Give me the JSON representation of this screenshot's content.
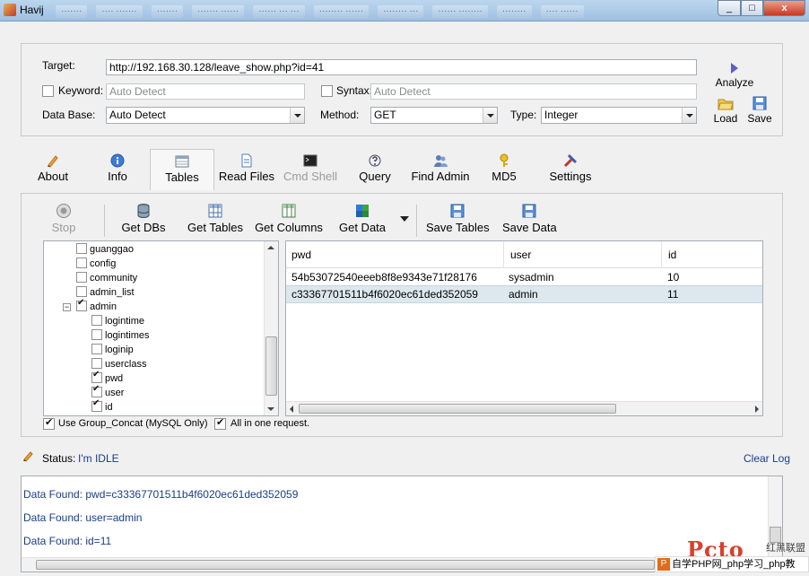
{
  "window": {
    "title": "Havij",
    "blurred_tabs": [
      "·······",
      "···· ·······",
      "·······",
      "······· ······",
      "······ ··· ···",
      "········ ······",
      "········ ···",
      "······ ········",
      "········",
      "···· ······"
    ],
    "min_label": "_",
    "max_label": "□",
    "close_label": "x"
  },
  "target": {
    "target_label": "Target:",
    "target_value": "http://192.168.30.128/leave_show.php?id=41",
    "keyword_label": "Keyword:",
    "keyword_placeholder": "Auto Detect",
    "syntax_label": "Syntax:",
    "syntax_placeholder": "Auto Detect",
    "database_label": "Data Base:",
    "database_value": "Auto Detect",
    "method_label": "Method:",
    "method_value": "GET",
    "type_label": "Type:",
    "type_value": "Integer",
    "analyze_label": "Analyze",
    "load_label": "Load",
    "save_label": "Save"
  },
  "tabs": [
    {
      "label": "About"
    },
    {
      "label": "Info"
    },
    {
      "label": "Tables"
    },
    {
      "label": "Read Files"
    },
    {
      "label": "Cmd Shell"
    },
    {
      "label": "Query"
    },
    {
      "label": "Find Admin"
    },
    {
      "label": "MD5"
    },
    {
      "label": "Settings"
    }
  ],
  "toolbar": {
    "stop": "Stop",
    "get_dbs": "Get DBs",
    "get_tables": "Get Tables",
    "get_columns": "Get Columns",
    "get_data": "Get Data",
    "save_tables": "Save Tables",
    "save_data": "Save Data"
  },
  "tree": {
    "tables": [
      "guanggao",
      "config",
      "community",
      "admin_list"
    ],
    "admin_table": "admin",
    "expander": "−",
    "columns": [
      {
        "name": "logintime",
        "checked": false
      },
      {
        "name": "logintimes",
        "checked": false
      },
      {
        "name": "loginip",
        "checked": false
      },
      {
        "name": "userclass",
        "checked": false
      },
      {
        "name": "pwd",
        "checked": true
      },
      {
        "name": "user",
        "checked": true
      },
      {
        "name": "id",
        "checked": true
      }
    ]
  },
  "grid": {
    "columns": [
      "pwd",
      "user",
      "id"
    ],
    "rows": [
      {
        "pwd": "54b53072540eeeb8f8e9343e71f28176",
        "user": "sysadmin",
        "id": "10"
      },
      {
        "pwd": "c33367701511b4f6020ec61ded352059",
        "user": "admin",
        "id": "11"
      }
    ]
  },
  "options": {
    "group_concat": "Use Group_Concat (MySQL Only)",
    "all_in_one": "All in one request."
  },
  "status": {
    "label": "Status:",
    "value": "I'm IDLE",
    "clear_log": "Clear Log"
  },
  "log": {
    "lines": [
      "Data Found: pwd=c33367701511b4f6020ec61ded352059",
      "Data Found: user=admin",
      "Data Found: id=11"
    ]
  },
  "watermark": {
    "logo_text": "Pcto",
    "cn_text": "红黑联盟",
    "bar_text": "自学PHP网_php学习_php教"
  }
}
